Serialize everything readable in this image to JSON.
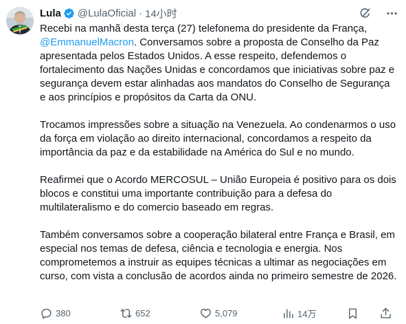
{
  "post": {
    "author_name": "Lula",
    "handle": "@LulaOficial",
    "separator": "·",
    "time": "14小时",
    "paragraphs": [
      {
        "before": "Recebi na manhã desta terça (27) telefonema do presidente da França, ",
        "mention": "@EmmanuelMacron",
        "after": ". Conversamos sobre a proposta de Conselho da Paz apresentada pelos Estados Unidos. A esse respeito, defendemos o fortalecimento das Nações Unidas e concordamos que iniciativas sobre paz e segurança devem estar alinhadas aos mandatos do Conselho de Segurança e aos princípios e propósitos da Carta da ONU."
      },
      {
        "text": "Trocamos impressões sobre a situação na Venezuela. Ao condenarmos o uso da força em violação ao direito internacional, concordamos a respeito da importância da paz e da estabilidade na América do Sul e no mundo."
      },
      {
        "text": "Reafirmei que o Acordo MERCOSUL – União Europeia é positivo para os dois blocos e constitui uma importante contribuição para a defesa do multilateralismo e do comercio baseado em regras."
      },
      {
        "text": "Também conversamos sobre a cooperação bilateral entre França e Brasil, em especial nos temas de defesa, ciência e tecnologia e energia. Nos comprometemos a instruir as equipes técnicas a ultimar as negociações em curso, com vista a conclusão de acordos ainda no primeiro semestre de 2026."
      }
    ]
  },
  "header_icons": [
    "grok-icon",
    "more-icon"
  ],
  "actions": {
    "replies": "380",
    "reposts": "652",
    "likes": "5,079",
    "views": "14万"
  },
  "colors": {
    "text": "#0f1419",
    "secondary": "#536471",
    "accent": "#1d9bf0",
    "verified": "#1d9bf0"
  }
}
